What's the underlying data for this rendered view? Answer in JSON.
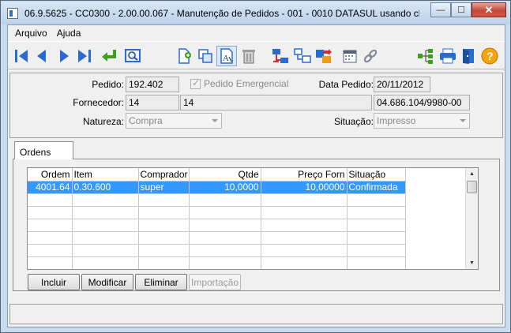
{
  "window": {
    "title": "06.9.5625 - CC0300 - 2.00.00.067 - Manutenção de Pedidos - 001 - 0010 DATASUL usando ch...",
    "minimize_glyph": "—",
    "maximize_glyph": "☐",
    "close_glyph": "✕"
  },
  "menu": {
    "items": [
      {
        "label": "Arquivo"
      },
      {
        "label": "Ajuda"
      }
    ]
  },
  "toolbar": {
    "icons": [
      "first-record-icon",
      "previous-record-icon",
      "next-record-icon",
      "last-record-icon",
      "go-to-icon",
      "search-icon",
      "new-document-icon",
      "copy-icon",
      "edit-icon",
      "delete-icon",
      "relationship-icon",
      "network-icon",
      "export-icon",
      "calendar-icon",
      "link-icon",
      "hierarchy-icon",
      "print-icon",
      "exit-icon",
      "help-icon"
    ]
  },
  "header": {
    "pedido_label": "Pedido:",
    "pedido_value": "192.402",
    "emergencial_label": "Pedido Emergencial",
    "emergencial_checked": true,
    "data_pedido_label": "Data Pedido:",
    "data_pedido_value": "20/11/2012",
    "fornecedor_label": "Fornecedor:",
    "fornecedor_code": "14",
    "fornecedor_name": "14",
    "fornecedor_cnpj": "04.686.104/9980-00",
    "natureza_label": "Natureza:",
    "natureza_value": "Compra",
    "situacao_label": "Situação:",
    "situacao_value": "Impresso"
  },
  "tabs": [
    {
      "label": "Ordens",
      "active": true
    }
  ],
  "grid": {
    "columns": [
      "Ordem",
      "Item",
      "Comprador",
      "Qtde",
      "Preço Forn",
      "Situação"
    ],
    "rows": [
      {
        "ordem": "4001.64",
        "item": "0.30.600",
        "comprador": "super",
        "qtde": "10,0000",
        "preco": "10,00000",
        "situacao": "Confirmada"
      }
    ]
  },
  "buttons": {
    "incluir": "Incluir",
    "modificar": "Modificar",
    "eliminar": "Eliminar",
    "importacao": "Importação"
  },
  "colors": {
    "selection": "#3399ff",
    "window_frame": "#c9dcee"
  }
}
